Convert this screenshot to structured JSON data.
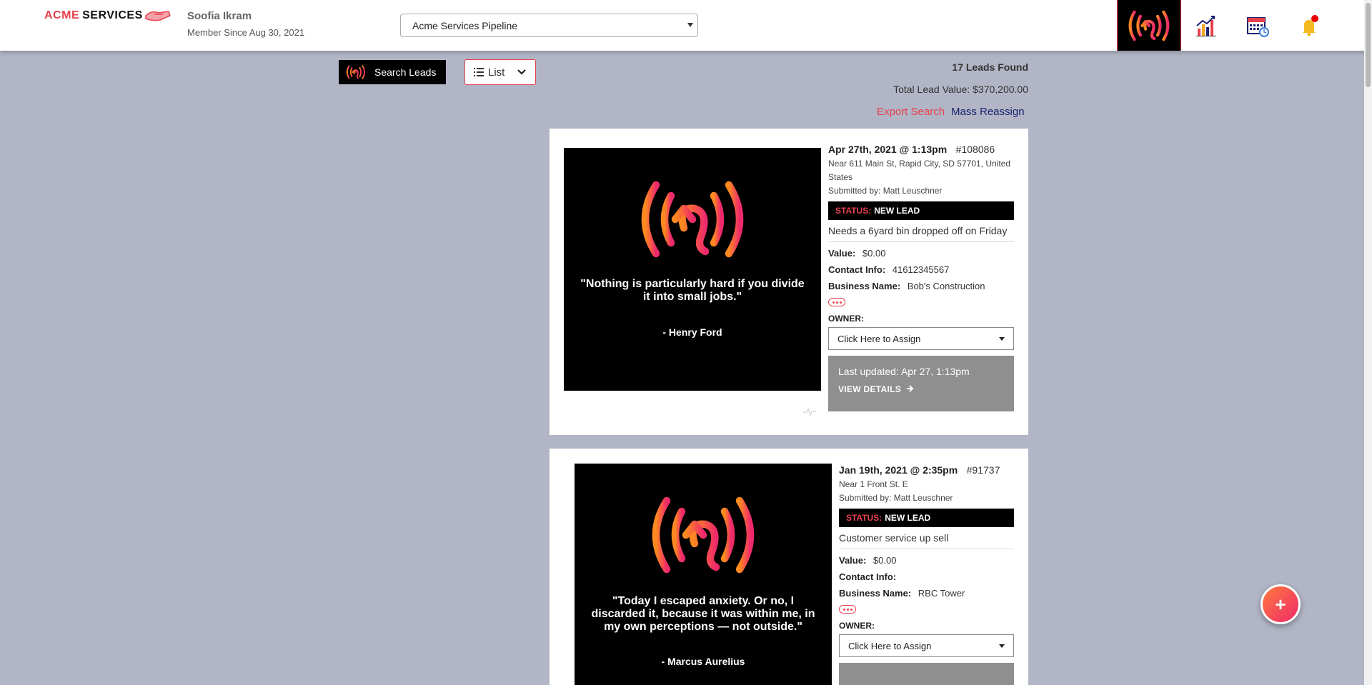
{
  "header": {
    "logo_acme": "ACME",
    "logo_services": "SERVICES",
    "user_name": "Soofia Ikram",
    "member_since": "Member Since Aug 30, 2021",
    "pipeline": "Acme Services Pipeline",
    "nav_icons": [
      "signal-logo-icon",
      "stats-chart-icon",
      "calendar-icon",
      "bell-icon"
    ]
  },
  "toolbar": {
    "search_label": "Search Leads",
    "view_label": "List",
    "leads_found": "17 Leads Found",
    "total_value": "Total Lead Value: $370,200.00",
    "export": "Export Search",
    "mass_reassign": "Mass Reassign"
  },
  "leads": [
    {
      "date": "Apr 27th, 2021 @ 1:13pm",
      "id": "#108086",
      "address": "Near 611 Main St, Rapid City, SD 57701, United States",
      "submitted": "Submitted by: Matt Leuschner",
      "status_label": "STATUS:",
      "status": "NEW LEAD",
      "description": "Needs a 6yard bin dropped off on Friday",
      "value_label": "Value:",
      "value": "$0.00",
      "contact_label": "Contact Info:",
      "contact": "41612345567",
      "business_label": "Business Name:",
      "business": "Bob's Construction",
      "owner_label": "OWNER:",
      "owner": "Click Here to Assign",
      "updated": "Last updated: Apr 27, 1:13pm",
      "details": "VIEW DETAILS",
      "quote": "\"Nothing is particularly hard if you divide it into small jobs.\"",
      "author": "- Henry Ford"
    },
    {
      "date": "Jan 19th, 2021 @ 2:35pm",
      "id": "#91737",
      "address": "Near 1 Front St. E",
      "submitted": "Submitted by: Matt Leuschner",
      "status_label": "STATUS:",
      "status": "NEW LEAD",
      "description": "Customer service up sell",
      "value_label": "Value:",
      "value": "$0.00",
      "contact_label": "Contact Info:",
      "contact": "",
      "business_label": "Business Name:",
      "business": "RBC Tower",
      "owner_label": "OWNER:",
      "owner": "Click Here to Assign",
      "quote": "\"Today I escaped anxiety. Or no, I discarded it, because it was within me, in my own perceptions — not outside.\"",
      "author": "- Marcus Aurelius"
    }
  ],
  "fab": {
    "label": "+"
  },
  "colors": {
    "accent": "#e8414e",
    "navy": "#1b2270",
    "background": "#b1b5c5",
    "gradient_start": "#ff7a3d",
    "gradient_end": "#ee2a6b"
  }
}
